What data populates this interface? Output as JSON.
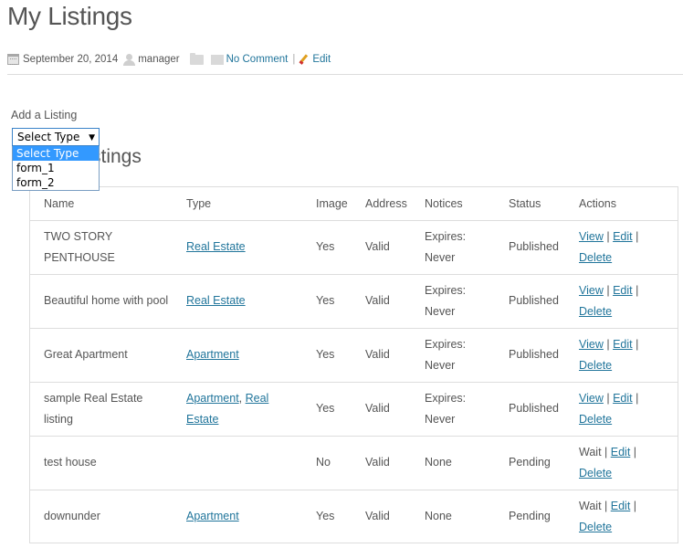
{
  "page": {
    "title": "My Listings"
  },
  "meta": {
    "date": "September 20, 2014",
    "author": "manager",
    "comments_link": "No Comment",
    "separator": "|",
    "edit_link": "Edit"
  },
  "add_listing": {
    "label": "Add a Listing",
    "select_value": "Select Type",
    "options": [
      "Select Type",
      "form_1",
      "form_2"
    ]
  },
  "section": {
    "title": "stings"
  },
  "table": {
    "headers": [
      "Name",
      "Type",
      "Image",
      "Address",
      "Notices",
      "Status",
      "Actions"
    ],
    "rows": [
      {
        "name": "TWO STORY PENTHOUSE",
        "types": [
          "Real Estate"
        ],
        "image": "Yes",
        "address": "Valid",
        "notices": "Expires: Never",
        "status": "Published",
        "action_first": "View",
        "action_first_is_link": true,
        "edit": "Edit",
        "delete": "Delete"
      },
      {
        "name": "Beautiful home with pool",
        "types": [
          "Real Estate"
        ],
        "image": "Yes",
        "address": "Valid",
        "notices": "Expires: Never",
        "status": "Published",
        "action_first": "View",
        "action_first_is_link": true,
        "edit": "Edit",
        "delete": "Delete"
      },
      {
        "name": "Great Apartment",
        "types": [
          "Apartment"
        ],
        "image": "Yes",
        "address": "Valid",
        "notices": "Expires: Never",
        "status": "Published",
        "action_first": "View",
        "action_first_is_link": true,
        "edit": "Edit",
        "delete": "Delete"
      },
      {
        "name": "sample Real Estate listing",
        "types": [
          "Apartment",
          "Real Estate"
        ],
        "image": "Yes",
        "address": "Valid",
        "notices": "Expires: Never",
        "status": "Published",
        "action_first": "View",
        "action_first_is_link": true,
        "edit": "Edit",
        "delete": "Delete"
      },
      {
        "name": "test house",
        "types": [],
        "image": "No",
        "address": "Valid",
        "notices": "None",
        "status": "Pending",
        "action_first": "Wait",
        "action_first_is_link": false,
        "edit": "Edit",
        "delete": "Delete"
      },
      {
        "name": "downunder",
        "types": [
          "Apartment"
        ],
        "image": "Yes",
        "address": "Valid",
        "notices": "None",
        "status": "Pending",
        "action_first": "Wait",
        "action_first_is_link": false,
        "edit": "Edit",
        "delete": "Delete"
      }
    ]
  },
  "colors": {
    "link": "#21759b",
    "text": "#555555",
    "border": "#dddddd",
    "dropdown_highlight": "#3399ff"
  }
}
